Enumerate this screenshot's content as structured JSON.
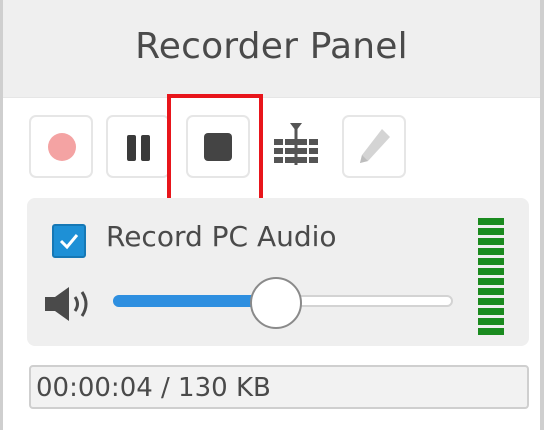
{
  "window": {
    "title": "Recorder Panel"
  },
  "toolbar": {
    "buttons": [
      {
        "name": "record",
        "icon": "record-icon",
        "enabled": false
      },
      {
        "name": "pause",
        "icon": "pause-icon",
        "enabled": true
      },
      {
        "name": "stop",
        "icon": "stop-icon",
        "enabled": true,
        "highlighted": true
      },
      {
        "name": "trim",
        "icon": "trim-icon",
        "enabled": true
      },
      {
        "name": "annotate",
        "icon": "pen-icon",
        "enabled": false
      }
    ]
  },
  "audio": {
    "record_pc_audio_label": "Record PC Audio",
    "record_pc_audio_checked": true,
    "volume_level": 0.48,
    "level_meter_segments": 12,
    "meter_color": "#1a8b1f"
  },
  "status": {
    "text": "00:00:04 / 130 KB"
  },
  "colors": {
    "highlight": "#e8151b",
    "slider_fill": "#2e8fe0",
    "checkbox": "#1e90d6"
  }
}
